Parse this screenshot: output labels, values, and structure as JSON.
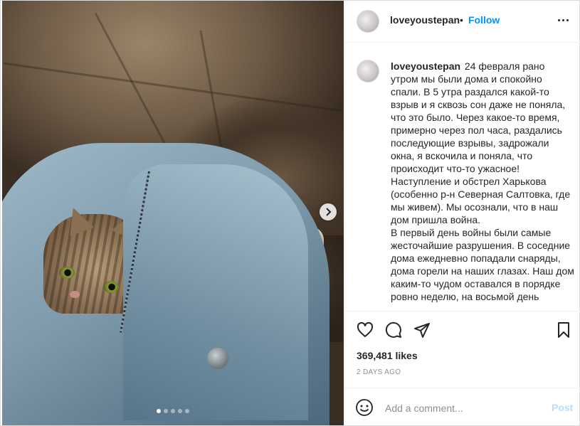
{
  "post": {
    "username": "loveyoustepan",
    "follow_label": "Follow",
    "bullet": "•",
    "caption": "24 февраля рано утром мы были дома и спокойно спали. В 5 утра раздался какой-то взрыв и я сквозь сон даже не поняла, что это было. Через какое-то время, примерно через пол часа, раздались последующие взрывы, задрожали окна, я вскочила и поняла, что происходит что-то ужасное!\nНаступление и обстрел Харькова (особенно р-н Северная Салтовка, где мы живем). Мы осознали, что в наш дом пришла война.\nВ первый день войны были самые жесточайшие разрушения. В соседние дома ежедневно попадали снаряды, дома горели на наших глазах. Наш дом каким-то чудом оставался в порядке ровно неделю, на восьмой день",
    "likes": "369,481 likes",
    "date": "2 DAYS AGO",
    "comment_placeholder": "Add a comment...",
    "post_label": "Post",
    "carousel": {
      "count": 5,
      "active": 1
    }
  },
  "icons": {
    "more": "more-options-icon",
    "like": "heart-icon",
    "comment": "comment-icon",
    "share": "paper-plane-icon",
    "save": "bookmark-icon",
    "emoji": "emoji-icon",
    "next": "chevron-right-icon"
  },
  "colors": {
    "accent": "#0095f6",
    "post_disabled": "#b2dffc",
    "secondary_text": "#8e8e8e"
  }
}
